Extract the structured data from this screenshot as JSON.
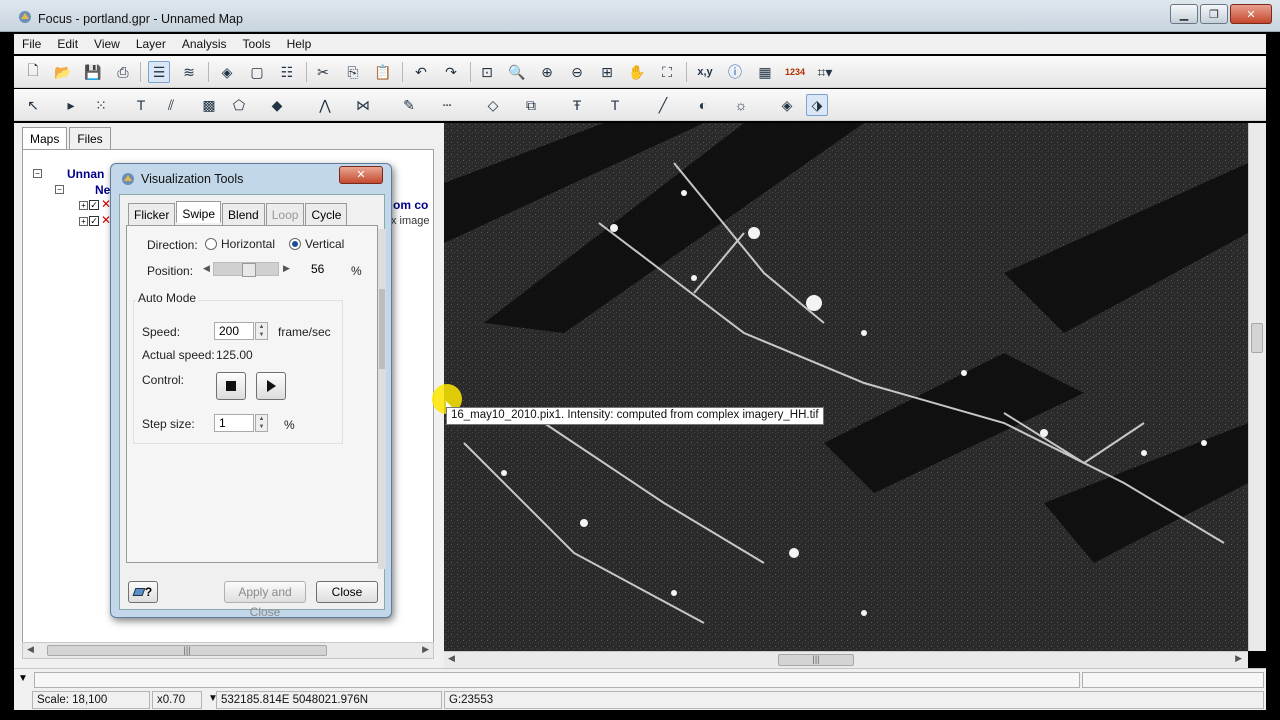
{
  "window": {
    "title": "Focus - portland.gpr - Unnamed Map",
    "min_label": "▁",
    "max_label": "❐",
    "close_label": "✕"
  },
  "menu": [
    "File",
    "Edit",
    "View",
    "Layer",
    "Analysis",
    "Tools",
    "Help"
  ],
  "left_panel": {
    "tabs": [
      "Maps",
      "Files"
    ],
    "tree": {
      "root": "Unnan",
      "child": "Ne",
      "item1_suffix": "om co",
      "item2_suffix": "x image"
    }
  },
  "dialog": {
    "title": "Visualization Tools",
    "close_label": "✕",
    "tabs": [
      "Flicker",
      "Swipe",
      "Blend",
      "Loop",
      "Cycle"
    ],
    "direction_label": "Direction:",
    "horizontal_label": "Horizontal",
    "vertical_label": "Vertical",
    "direction_selected": "Vertical",
    "position_label": "Position:",
    "position_value": "56",
    "position_unit": "%",
    "position_fraction": 0.56,
    "auto_mode_label": "Auto Mode",
    "speed_label": "Speed:",
    "speed_value": "200",
    "speed_unit": "frame/sec",
    "actual_speed_label": "Actual speed:",
    "actual_speed_value": "125.00",
    "control_label": "Control:",
    "step_size_label": "Step size:",
    "step_size_value": "1",
    "step_size_unit": "%",
    "help_label": "?",
    "apply_close_label": "Apply and Close",
    "close_button_label": "Close"
  },
  "map": {
    "tooltip": "16_may10_2010.pix1. Intensity: computed from complex imagery_HH.tif"
  },
  "status": {
    "scale": "Scale: 18,100",
    "zoom": "x0.70",
    "coords": "532185.814E 5048021.976N",
    "gray": "G:23553"
  },
  "scroll_grip": "|||"
}
